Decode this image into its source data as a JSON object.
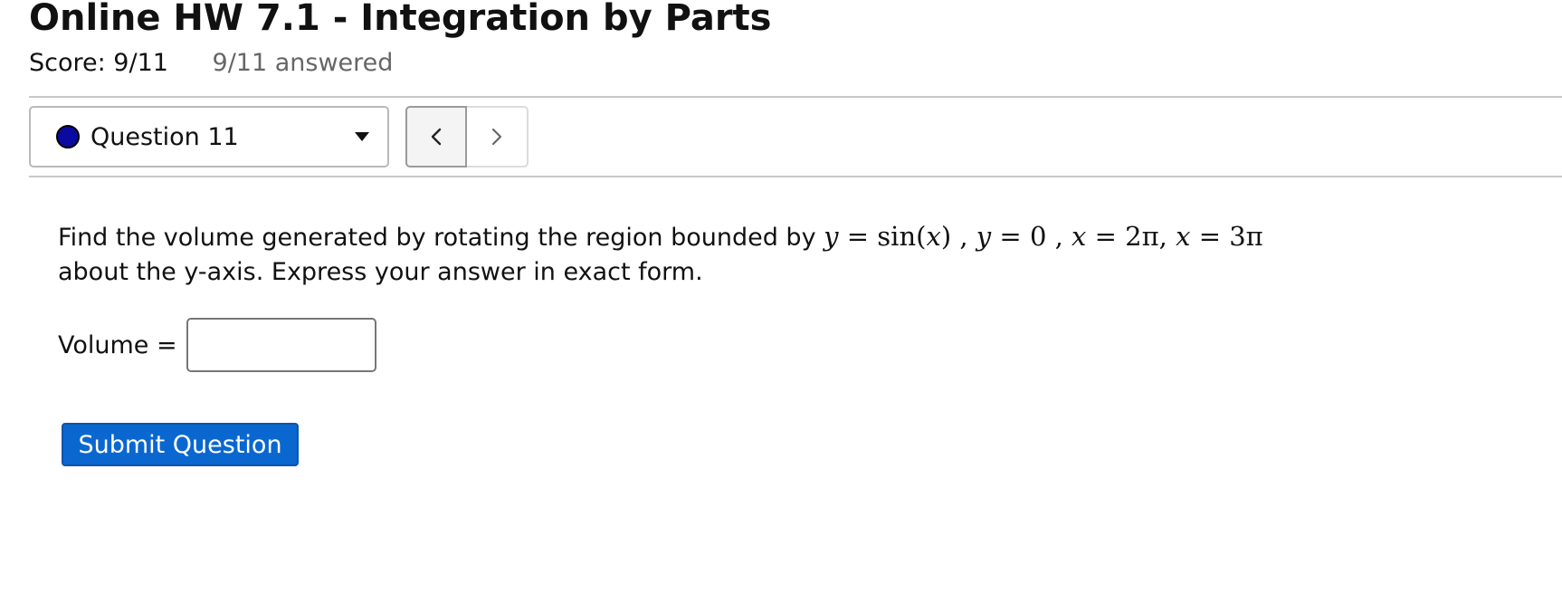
{
  "header": {
    "title": "Online HW 7.1 - Integration by Parts",
    "score": "Score: 9/11",
    "answered": "9/11 answered"
  },
  "question_nav": {
    "selected_question": "Question 11",
    "status_color": "#0a0aa3",
    "status_icon": "filled-circle-icon",
    "dropdown_icon": "caret-down-icon",
    "prev_icon": "chevron-left-icon",
    "next_icon": "chevron-right-icon"
  },
  "question": {
    "text_before_math": "Find the volume generated by rotating the region bounded by",
    "math_y1": "y",
    "math_eq": "=",
    "math_sin": "sin(",
    "math_x": "x",
    "math_close": ")",
    "comma": ",",
    "math_y2": "y",
    "math_zero": "0",
    "math_x1": "x",
    "math_2pi": "2π",
    "math_x2": "x",
    "math_3pi": "3π",
    "text_after_math": "about the y-axis. Express your answer in exact form."
  },
  "answer": {
    "label": "Volume =",
    "value": ""
  },
  "actions": {
    "submit_label": "Submit Question",
    "submit_color": "#0a67d0"
  }
}
